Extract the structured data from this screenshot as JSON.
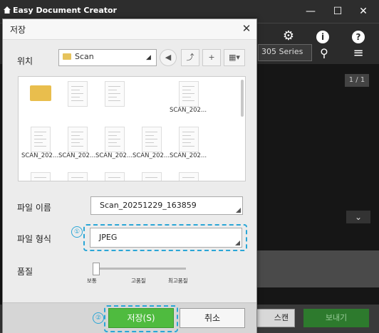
{
  "app": {
    "title": "Easy Document Creator",
    "window_buttons": {
      "minimize": "—",
      "maximize": "☐",
      "close": "✕"
    },
    "toolbar_icons": [
      "gear-icon",
      "info-icon",
      "help-icon"
    ],
    "toolbar_glyphs": {
      "gear": "⚙",
      "info": "i",
      "help": "?",
      "search": "⚲",
      "menu": "≡"
    },
    "scanner_select": "305 Series",
    "page_counter": "1 / 1",
    "collapse": "⌄",
    "scan_button": "스캔",
    "send_button": "보내기"
  },
  "dialog": {
    "title": "저장",
    "close": "✕",
    "location": {
      "label": "위치",
      "value": "Scan"
    },
    "files": [
      {
        "name": "",
        "type": "folder"
      },
      {
        "name": "",
        "type": "doc"
      },
      {
        "name": "",
        "type": "doc"
      },
      {
        "name": "",
        "type": "blank"
      },
      {
        "name": "SCAN_202...",
        "type": "doc"
      },
      {
        "name": "SCAN_202...",
        "type": "doc"
      },
      {
        "name": "SCAN_202...",
        "type": "doc"
      },
      {
        "name": "SCAN_202...",
        "type": "doc"
      },
      {
        "name": "SCAN_202...",
        "type": "doc"
      },
      {
        "name": "SCAN_202...",
        "type": "doc"
      },
      {
        "name": "",
        "type": "doc"
      },
      {
        "name": "",
        "type": "doc"
      },
      {
        "name": "",
        "type": "doc"
      },
      {
        "name": "",
        "type": "doc"
      },
      {
        "name": "",
        "type": "doc"
      }
    ],
    "filename": {
      "label": "파일 이름",
      "value": "Scan_20251229_163859"
    },
    "filetype": {
      "label": "파일 형식",
      "value": "JPEG",
      "marker": "①"
    },
    "quality": {
      "label": "품질",
      "level": 0,
      "ticks": [
        "보통",
        "고품질",
        "최고품질"
      ]
    },
    "save_button": "저장(S)",
    "save_marker": "②",
    "cancel_button": "취소"
  },
  "colors": {
    "highlight": "#2aa6d6",
    "save_green": "#4fbb3f"
  }
}
